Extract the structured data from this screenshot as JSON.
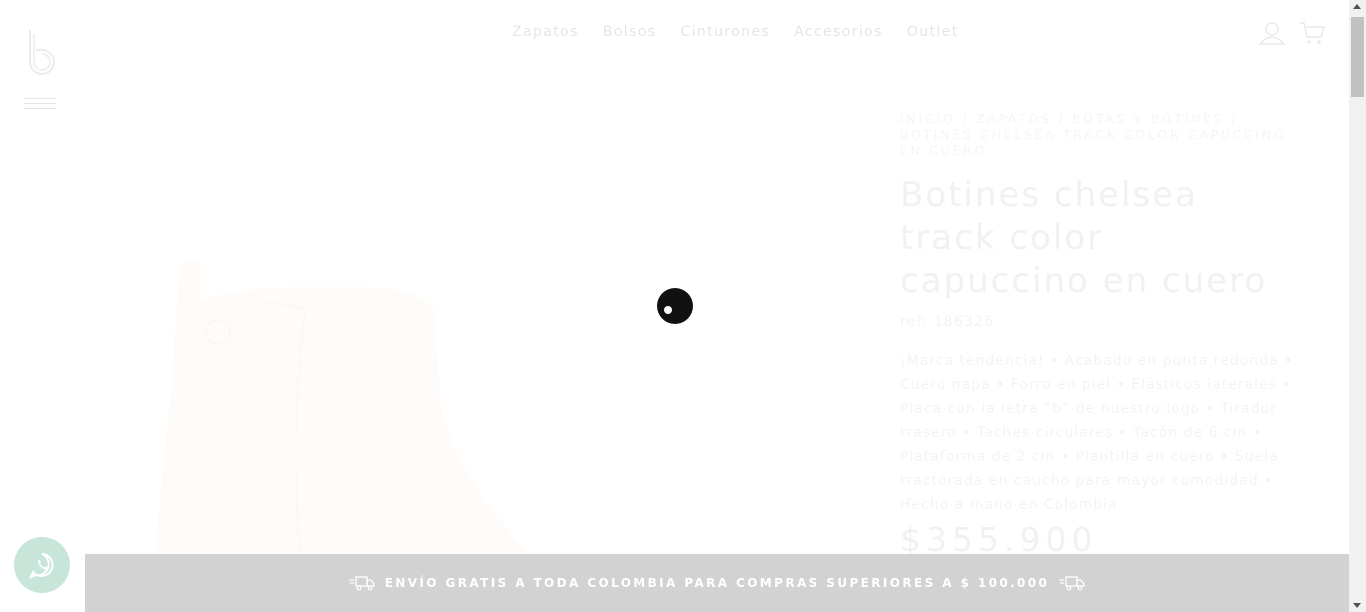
{
  "header": {
    "nav": [
      "Zapatos",
      "Bolsos",
      "Cinturones",
      "Accesorios",
      "Outlet"
    ]
  },
  "breadcrumb": {
    "items": [
      "Inicio",
      "Zapatos",
      "Botas y botines",
      "Botines chelsea track color capuccino en cuero"
    ],
    "separator": " / "
  },
  "product": {
    "title": "Botines chelsea track color capuccino en cuero",
    "ref": "ref: 186326",
    "description": "¡Marca tendencia! • Acabado en punta redonda • Cuero napa • Forro en piel • Elásticos laterales • Placa con la letra “b” de nuestro logo • Tirador trasero • Taches circulares • Tacón de 6 cm • Plataforma de 2 cm • Plantilla en cuero • Suela tractorada en caucho para mayor comodidad • Hecho a mano en Colombia",
    "price": "$355.900"
  },
  "banner": {
    "text": "ENVÍO GRATIS A TODA COLOMBIA PARA COMPRAS SUPERIORES A $ 100.000"
  },
  "colors": {
    "banner_bg": "#d2d2d2",
    "whatsapp": "#c7e6d9",
    "spinner": "#111111"
  },
  "icons": [
    "brand-logo-icon",
    "hamburger-menu-icon",
    "user-icon",
    "cart-icon",
    "whatsapp-icon",
    "truck-icon",
    "loading-spinner-icon"
  ]
}
